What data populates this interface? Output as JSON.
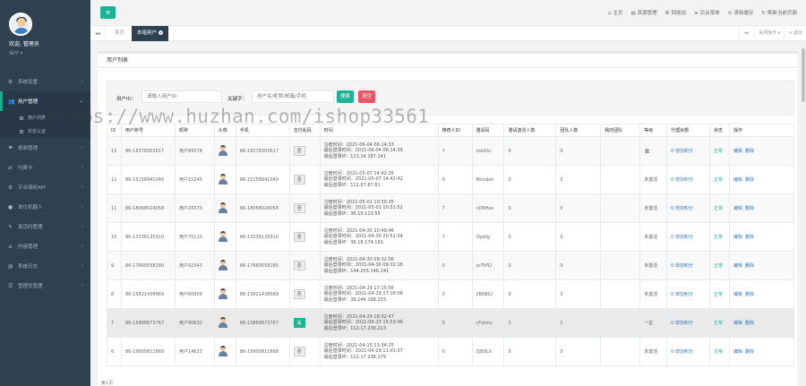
{
  "sidebar": {
    "welcome": "欢迎, 管理员",
    "role": "操作 ▾",
    "items": [
      {
        "icon": "⚙",
        "label": "系统设置",
        "arrow": "‹"
      },
      {
        "icon": "👥",
        "label": "用户管理",
        "arrow": "⌄",
        "active": true
      },
      {
        "icon": "⚑",
        "label": "视频管理",
        "arrow": "‹"
      },
      {
        "icon": "⇄",
        "label": "付费卡",
        "arrow": "‹"
      },
      {
        "icon": "⚙",
        "label": "平台授权API",
        "arrow": "‹"
      },
      {
        "icon": "●",
        "label": "单位机器人",
        "arrow": "‹"
      },
      {
        "icon": "✎",
        "label": "激活码管理",
        "arrow": "‹"
      },
      {
        "icon": "≡",
        "label": "内容管理",
        "arrow": "‹"
      },
      {
        "icon": "▤",
        "label": "系统日志",
        "arrow": "‹"
      },
      {
        "icon": "☰",
        "label": "管理员管理",
        "arrow": "‹"
      }
    ],
    "sub_items": [
      "用户列表",
      "实名认证"
    ]
  },
  "topbar": {
    "menu_icon": "≡",
    "links": [
      {
        "icon": "⌂",
        "label": "主页"
      },
      {
        "icon": "▤",
        "label": "资源管理"
      },
      {
        "icon": "♻",
        "label": "回收站"
      },
      {
        "icon": "≡",
        "label": "后台菜单"
      },
      {
        "icon": "⊘",
        "label": "清除缓存"
      },
      {
        "icon": "↻",
        "label": "刷新当前页面"
      }
    ]
  },
  "tabs": {
    "prev": "◂◂",
    "next": "▸▸",
    "home": "首页",
    "active": "本组用户",
    "close_icon": "×",
    "right": [
      "关闭操作 ▾",
      "↪ 退出"
    ]
  },
  "panel": {
    "title": "用户列表",
    "search": {
      "uid_label": "用户ID：",
      "uid_placeholder": "请输入用户ID",
      "keyword_label": "关键字：",
      "keyword_placeholder": "用户名/昵称/邮箱/手机",
      "search_btn": "搜索",
      "clear_btn": "清空"
    }
  },
  "table": {
    "headers": [
      "ID",
      "用户账号",
      "昵称",
      "头像",
      "手机",
      "支付乱码",
      "时间",
      "推荐人ID",
      "邀请码",
      "邀请激活人数",
      "团队人数",
      "我的团队",
      "等级",
      "代理余额",
      "状态",
      "操作"
    ],
    "rows": [
      {
        "id": "13",
        "account": "86-18378303617",
        "nick": "用户84378",
        "phone": "86-18378303617",
        "pay": "否",
        "pay_yes": false,
        "times": [
          "注册时间：2021-06-04 06:14:33",
          "最后登录时间：2021-06-04 06:14:39",
          "最后登录IP：113.14.187.141"
        ],
        "ref": "7",
        "code": "ssbXfu",
        "act": "0",
        "team": "0",
        "my_team": "",
        "level": "🏛",
        "balance": "0 增加积分",
        "status": "正常",
        "ops": [
          "编辑",
          "删除"
        ]
      },
      {
        "id": "12",
        "account": "86-15158941040",
        "nick": "用户15245",
        "phone": "86-15158941040",
        "pay": "否",
        "pay_yes": false,
        "times": [
          "注册时间：2021-05-07 14:42:25",
          "最后登录时间：2021-05-07 14:42:42",
          "最后登录IP：112.67.87.81"
        ],
        "ref": "0",
        "code": "Ntmdon",
        "act": "0",
        "team": "0",
        "my_team": "",
        "level": "未激活",
        "balance": "0 增加积分",
        "status": "正常",
        "ops": [
          "编辑",
          "删除"
        ]
      },
      {
        "id": "11",
        "account": "86-18068024058",
        "nick": "用户24370",
        "phone": "86-18068024058",
        "pay": "否",
        "pay_yes": false,
        "times": [
          "注册时间：2021-05-01 10:50:35",
          "最后登录时间：2021-05-01 10:51:52",
          "最后登录IP：36.19.113.55"
        ],
        "ref": "7",
        "code": "nD6Hav",
        "act": "0",
        "team": "0",
        "my_team": "",
        "level": "未激活",
        "balance": "0 增加积分",
        "status": "正常",
        "ops": [
          "编辑",
          "删除"
        ]
      },
      {
        "id": "10",
        "account": "86-13336135910",
        "nick": "用户75113",
        "phone": "86-13336135910",
        "pay": "否",
        "pay_yes": false,
        "times": [
          "注册时间：2021-04-30 20:49:46",
          "最后登录时间：2021-04-30 20:51:04",
          "最后登录IP：36.18.174.163"
        ],
        "ref": "7",
        "code": "i2pdIg",
        "act": "0",
        "team": "0",
        "my_team": "",
        "level": "未激活",
        "balance": "0 增加积分",
        "status": "正常",
        "ops": [
          "编辑",
          "删除"
        ]
      },
      {
        "id": "9",
        "account": "86-17660558280",
        "nick": "用户92343",
        "phone": "86-17660558280",
        "pay": "否",
        "pay_yes": false,
        "times": [
          "注册时间：2021-04-30 09:32:06",
          "最后登录时间：2021-04-30 09:32:18",
          "最后登录IP：144.255.146.241"
        ],
        "ref": "0",
        "code": "scTtPQ",
        "act": "0",
        "team": "0",
        "my_team": "",
        "level": "未激活",
        "balance": "0 增加积分",
        "status": "正常",
        "ops": [
          "编辑",
          "删除"
        ]
      },
      {
        "id": "8",
        "account": "86-15821438669",
        "nick": "用户60809",
        "phone": "86-15821438669",
        "pay": "否",
        "pay_yes": false,
        "times": [
          "注册时间：2021-04-29 17:15:56",
          "最后登录时间：2021-04-29 17:16:06",
          "最后登录IP：39.144.168.233"
        ],
        "ref": "0",
        "code": "2B6BIU",
        "act": "0",
        "team": "0",
        "my_team": "",
        "level": "未激活",
        "balance": "0 增加积分",
        "status": "正常",
        "ops": [
          "编辑",
          "删除"
        ]
      },
      {
        "id": "7",
        "account": "86-15888873767",
        "nick": "用户90632",
        "phone": "86-15888873767",
        "pay": "是",
        "pay_yes": true,
        "times": [
          "注册时间：2021-04-29 16:02:47",
          "最后登录时间：2021-05-13 15:53:46",
          "最后登录IP：112.17.236.213"
        ],
        "ref": "0",
        "code": "cFxtmv",
        "act": "1",
        "team": "1",
        "my_team": "",
        "level": "一星",
        "balance": "0 增加积分",
        "status": "正常",
        "ops": [
          "编辑",
          "删除"
        ]
      },
      {
        "id": "6",
        "account": "86-19905811668",
        "nick": "用户14623",
        "phone": "86-19905811668",
        "pay": "否",
        "pay_yes": false,
        "times": [
          "注册时间：2021-04-15 13:34:25",
          "最后登录时间：2021-04-29 11:01:07",
          "最后登录IP：112.17.236.179"
        ],
        "ref": "0",
        "code": "QjE0Lh",
        "act": "0",
        "team": "0",
        "my_team": "",
        "level": "未激活",
        "balance": "0 增加积分",
        "status": "正常",
        "ops": [
          "编辑",
          "删除"
        ]
      }
    ]
  },
  "watermark": "https://www.huzhan.com/ishop33561",
  "footer": "第1页"
}
